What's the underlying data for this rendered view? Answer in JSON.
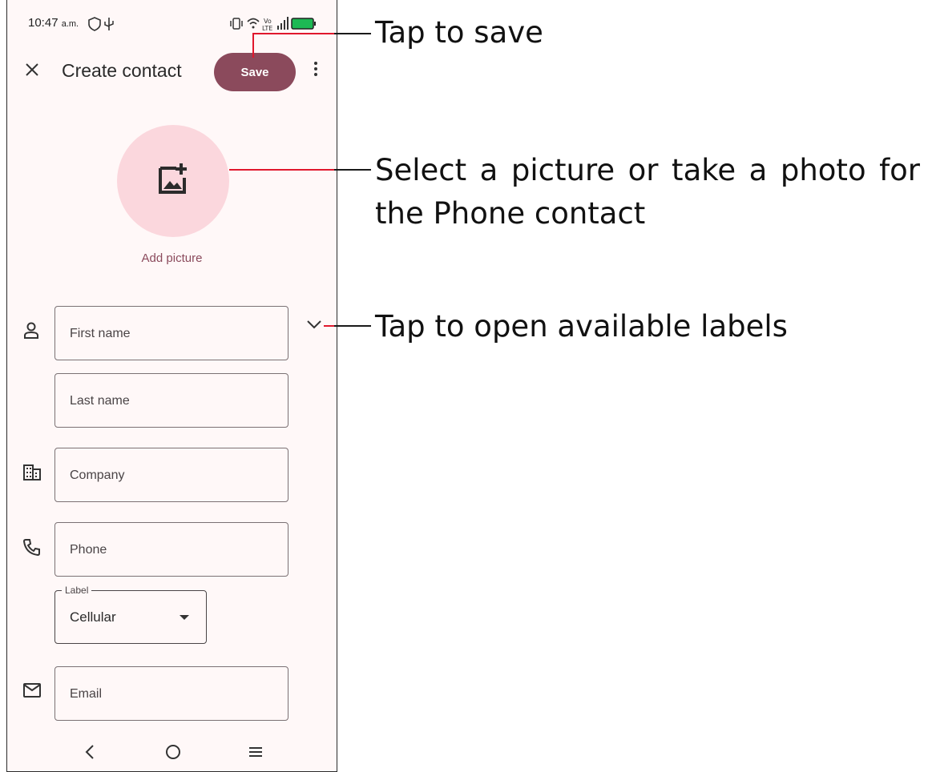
{
  "status_bar": {
    "time": "10:47",
    "ampm": "a.m.",
    "battery": "97"
  },
  "app_bar": {
    "title": "Create contact",
    "save_label": "Save"
  },
  "photo": {
    "add_picture_label": "Add picture"
  },
  "form": {
    "first_name_placeholder": "First name",
    "last_name_placeholder": "Last name",
    "company_placeholder": "Company",
    "phone_placeholder": "Phone",
    "phone_label_legend": "Label",
    "phone_label_value": "Cellular",
    "email_placeholder": "Email"
  },
  "annotations": {
    "save_note": "Tap to save",
    "picture_note_line1": "Select a picture or take a photo for",
    "picture_note_line2": "the Phone contact",
    "labels_note": "Tap to open available labels"
  },
  "colors": {
    "accent": "#8b4a5c",
    "avatar_bg": "#fbd7dd",
    "callout": "#e0182d",
    "surface": "#fff8f8"
  }
}
